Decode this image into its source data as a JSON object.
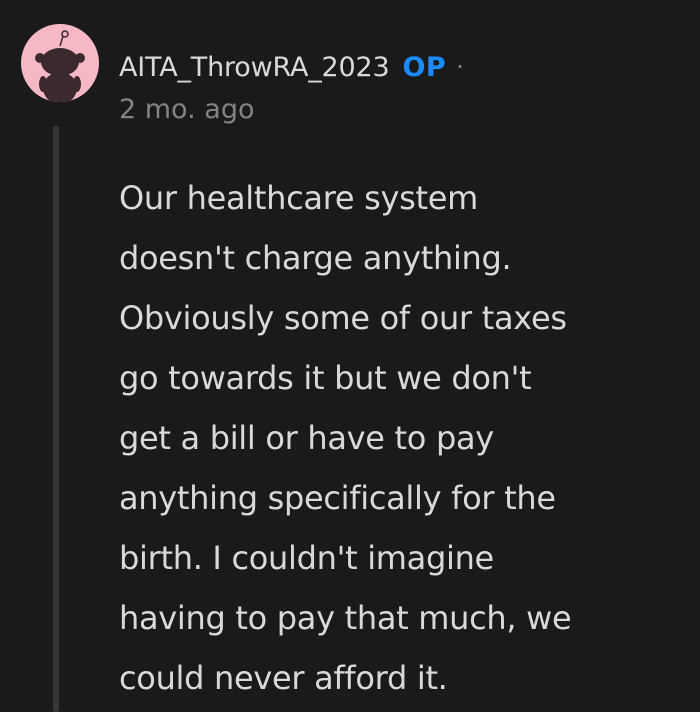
{
  "comment": {
    "author": "AITA_ThrowRA_2023",
    "badge": "OP",
    "separator": "·",
    "timestamp": "2 mo. ago",
    "avatar_icon": "snoo-avatar-icon",
    "body_lines": [
      "Our healthcare system",
      "doesn't charge anything.",
      "Obviously some of our taxes",
      "go towards it but we don't",
      "get a bill or have to pay",
      "anything specifically for the",
      "birth. I couldn't imagine",
      "having to pay that much, we",
      "could never afford it."
    ]
  },
  "colors": {
    "background": "#1a1a1b",
    "text": "#d7dadc",
    "muted": "#818384",
    "op_badge": "#1a8cff",
    "avatar_bg": "#f6b8c5",
    "thread_line": "#343536"
  }
}
